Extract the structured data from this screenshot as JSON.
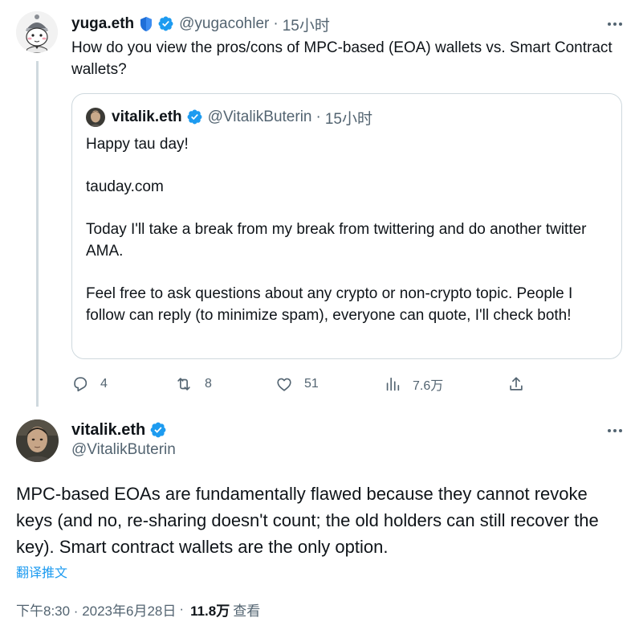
{
  "parent_tweet": {
    "display_name": "yuga.eth",
    "handle": "@yugacohler",
    "separator": "·",
    "timestamp": "15小时",
    "text": "How do you view the pros/cons of MPC-based (EOA) wallets vs. Smart Contract wallets?",
    "quoted_tweet": {
      "display_name": "vitalik.eth",
      "handle": "@VitalikButerin",
      "separator": "·",
      "timestamp": "15小时",
      "paragraphs": [
        "Happy tau day!",
        "tauday.com",
        "Today I'll take a break from my break from twittering and do another twitter AMA.",
        "Feel free to ask questions about any crypto or non-crypto topic. People I follow can reply (to minimize spam), everyone can quote, I'll check both!"
      ]
    },
    "actions": {
      "replies": "4",
      "retweets": "8",
      "likes": "51",
      "views": "7.6万"
    }
  },
  "main_tweet": {
    "display_name": "vitalik.eth",
    "handle": "@VitalikButerin",
    "text": "MPC-based EOAs are fundamentally flawed because they cannot revoke keys (and no, re-sharing doesn't count; the old holders can still recover the key). Smart contract wallets are the only option.",
    "translate_link": "翻译推文",
    "timestamp": "下午8:30 · 2023年6月28日",
    "meta_separator": "·",
    "views_count": "11.8万",
    "views_label": "查看"
  },
  "colors": {
    "verified_blue": "#1d9bf0",
    "secondary_text": "#536471",
    "border": "#cfd9de",
    "text": "#0f1419",
    "link": "#1d9bf0"
  },
  "icons": {
    "reply": "reply-icon",
    "retweet": "retweet-icon",
    "like": "heart-icon",
    "views": "views-chart-icon",
    "share": "share-icon",
    "more": "more-horizontal-icon",
    "verified": "verified-badge-icon",
    "shield": "shield-emoji-icon"
  }
}
